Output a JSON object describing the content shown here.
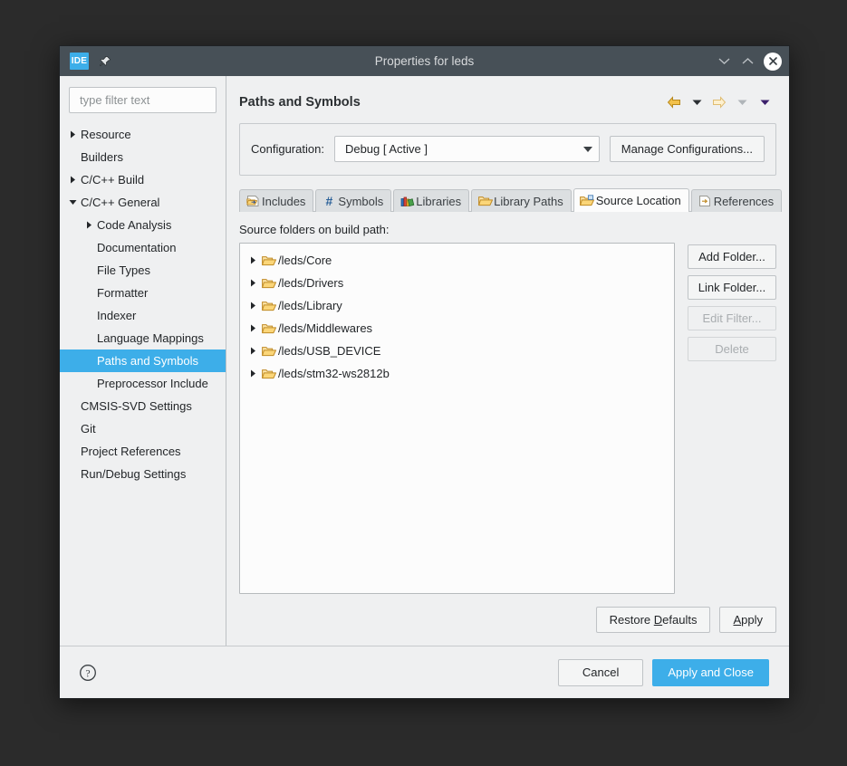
{
  "window": {
    "title": "Properties for leds",
    "app_badge": "IDE",
    "icons": {
      "pin": "pin-icon",
      "minimize": "chevron-down-icon",
      "maximize": "chevron-up-icon",
      "close": "close-icon"
    }
  },
  "colors": {
    "titlebar": "#475057",
    "accent": "#3daee9",
    "panel": "#eff0f1",
    "field": "#fcfcfc",
    "border": "#bfc3c6",
    "text": "#232629",
    "disabled_text": "#a9adb0"
  },
  "sidebar": {
    "filter": {
      "value": "",
      "placeholder": "type filter text"
    },
    "items": [
      {
        "label": "Resource",
        "depth": 0,
        "twisty": "collapsed",
        "selected": false
      },
      {
        "label": "Builders",
        "depth": 0,
        "twisty": "none",
        "selected": false
      },
      {
        "label": "C/C++ Build",
        "depth": 0,
        "twisty": "collapsed",
        "selected": false
      },
      {
        "label": "C/C++ General",
        "depth": 0,
        "twisty": "expanded",
        "selected": false
      },
      {
        "label": "Code Analysis",
        "depth": 1,
        "twisty": "collapsed",
        "selected": false
      },
      {
        "label": "Documentation",
        "depth": 1,
        "twisty": "none",
        "selected": false
      },
      {
        "label": "File Types",
        "depth": 1,
        "twisty": "none",
        "selected": false
      },
      {
        "label": "Formatter",
        "depth": 1,
        "twisty": "none",
        "selected": false
      },
      {
        "label": "Indexer",
        "depth": 1,
        "twisty": "none",
        "selected": false
      },
      {
        "label": "Language Mappings",
        "depth": 1,
        "twisty": "none",
        "selected": false
      },
      {
        "label": "Paths and Symbols",
        "depth": 1,
        "twisty": "none",
        "selected": true
      },
      {
        "label": "Preprocessor Include",
        "depth": 1,
        "twisty": "none",
        "selected": false
      },
      {
        "label": "CMSIS-SVD Settings",
        "depth": 0,
        "twisty": "none",
        "selected": false
      },
      {
        "label": "Git",
        "depth": 0,
        "twisty": "none",
        "selected": false
      },
      {
        "label": "Project References",
        "depth": 0,
        "twisty": "none",
        "selected": false
      },
      {
        "label": "Run/Debug Settings",
        "depth": 0,
        "twisty": "none",
        "selected": false
      }
    ]
  },
  "content": {
    "page_title": "Paths and Symbols",
    "nav": [
      {
        "name": "back-arrow-icon",
        "state": "enabled"
      },
      {
        "name": "back-history-caret-icon",
        "state": "enabled"
      },
      {
        "name": "forward-arrow-icon",
        "state": "disabled"
      },
      {
        "name": "forward-history-caret-icon",
        "state": "disabled"
      },
      {
        "name": "view-menu-caret-icon",
        "state": "enabled"
      }
    ],
    "configuration": {
      "label": "Configuration:",
      "value": "Debug  [ Active ]",
      "manage_button": "Manage Configurations..."
    },
    "tabs": [
      {
        "label": "Includes",
        "icon": "includes-folder-icon",
        "active": false
      },
      {
        "label": "Symbols",
        "icon": "hash-icon",
        "active": false
      },
      {
        "label": "Libraries",
        "icon": "books-icon",
        "active": false
      },
      {
        "label": "Library Paths",
        "icon": "open-folder-icon",
        "active": false
      },
      {
        "label": "Source Location",
        "icon": "source-folder-icon",
        "active": true
      },
      {
        "label": "References",
        "icon": "references-arrow-icon",
        "active": false
      }
    ],
    "source_location": {
      "list_label": "Source folders on build path:",
      "folders": [
        "/leds/Core",
        "/leds/Drivers",
        "/leds/Library",
        "/leds/Middlewares",
        "/leds/USB_DEVICE",
        "/leds/stm32-ws2812b"
      ],
      "buttons": [
        {
          "label": "Add Folder...",
          "enabled": true
        },
        {
          "label": "Link Folder...",
          "enabled": true
        },
        {
          "label": "Edit Filter...",
          "enabled": false
        },
        {
          "label": "Delete",
          "enabled": false
        }
      ]
    },
    "apply_row": {
      "restore_defaults": {
        "pre": "Restore ",
        "mnemonic": "D",
        "post": "efaults"
      },
      "apply": {
        "pre": "",
        "mnemonic": "A",
        "post": "pply"
      }
    }
  },
  "footer": {
    "help_icon": "help-icon",
    "cancel": "Cancel",
    "apply_and_close": "Apply and Close"
  }
}
